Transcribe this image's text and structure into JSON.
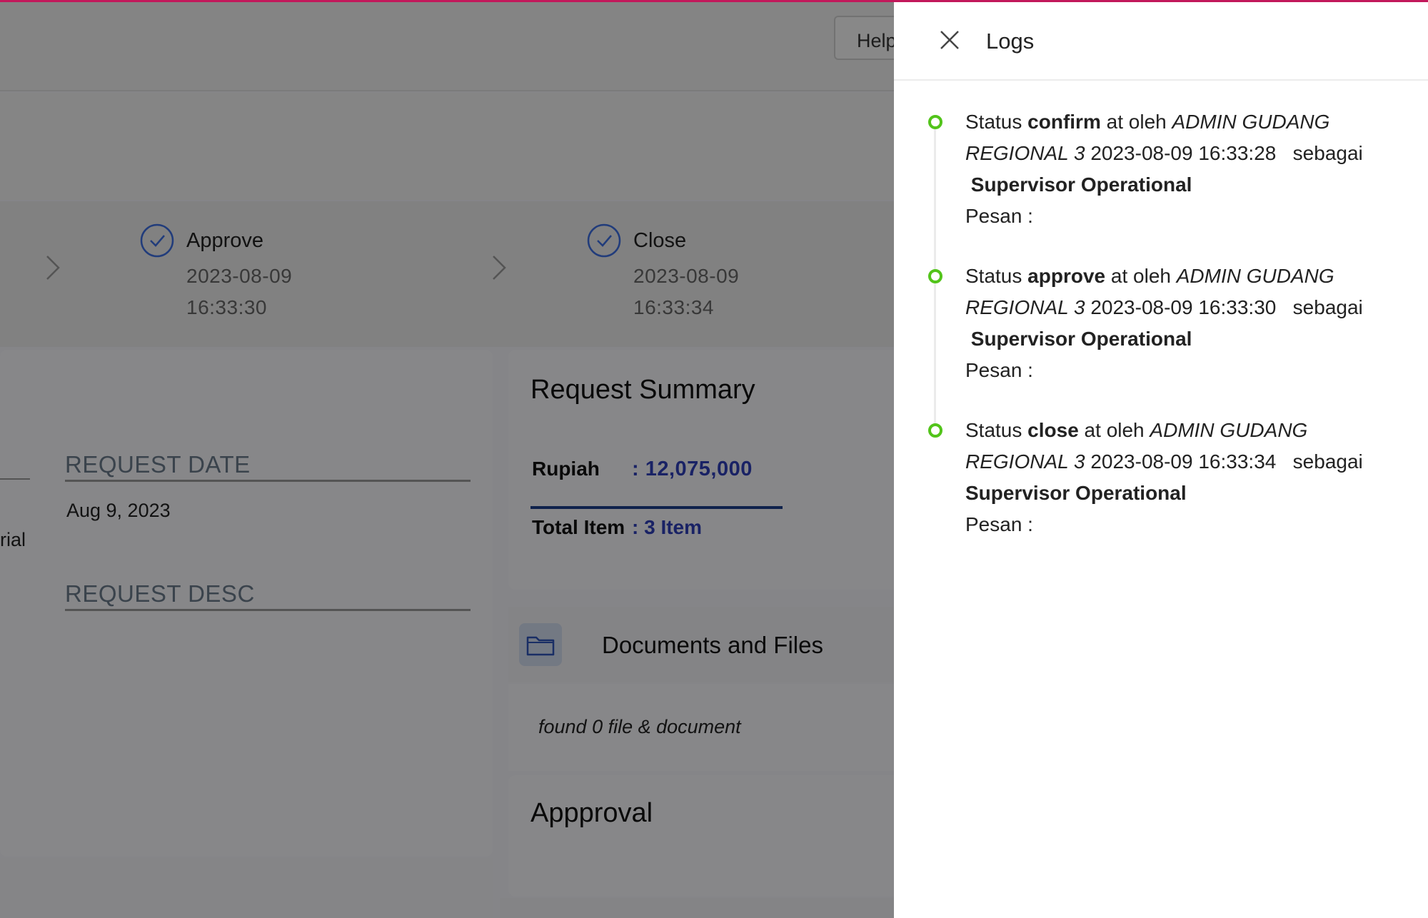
{
  "header": {
    "help_label": "Help"
  },
  "stepper": {
    "steps": [
      {
        "label": "Approve",
        "date": "2023-08-09",
        "time": "16:33:30"
      },
      {
        "label": "Close",
        "date": "2023-08-09",
        "time": "16:33:34"
      }
    ]
  },
  "request": {
    "partial_left_text": "rial",
    "date_label": "REQUEST DATE",
    "date_value": "Aug 9, 2023",
    "desc_label": "REQUEST DESC"
  },
  "summary": {
    "title": "Request Summary",
    "rupiah_label": "Rupiah",
    "rupiah_value": ": 12,075,000",
    "total_label": "Total Item",
    "total_value": ": 3 Item"
  },
  "documents": {
    "title": "Documents and Files",
    "empty_text": "found 0 file & document"
  },
  "approval": {
    "title": "Appproval"
  },
  "drawer": {
    "title": "Logs",
    "logs": [
      {
        "prefix": "Status ",
        "status": "confirm",
        "mid": " at oleh ",
        "user": "ADMIN GUDANG REGIONAL 3",
        "timestamp": " 2023-08-09 16:33:28",
        "sebagai": "   sebagai ",
        "role": " Supervisor Operational",
        "pesan": "Pesan :"
      },
      {
        "prefix": "Status ",
        "status": "approve",
        "mid": " at oleh ",
        "user": "ADMIN GUDANG REGIONAL 3",
        "timestamp": " 2023-08-09 16:33:30",
        "sebagai": "   sebagai ",
        "role": " Supervisor Operational",
        "pesan": "Pesan :"
      },
      {
        "prefix": "Status ",
        "status": "close",
        "mid": " at oleh ",
        "user": "ADMIN GUDANG REGIONAL 3",
        "timestamp": " 2023-08-09 16:33:34",
        "sebagai": "   sebagai ",
        "role": " Supervisor Operational",
        "pesan": "Pesan :"
      }
    ]
  },
  "colors": {
    "accent": "#c2185b",
    "success": "#52c41a",
    "link": "#2f3fb8",
    "step": "#3d6ee0"
  }
}
